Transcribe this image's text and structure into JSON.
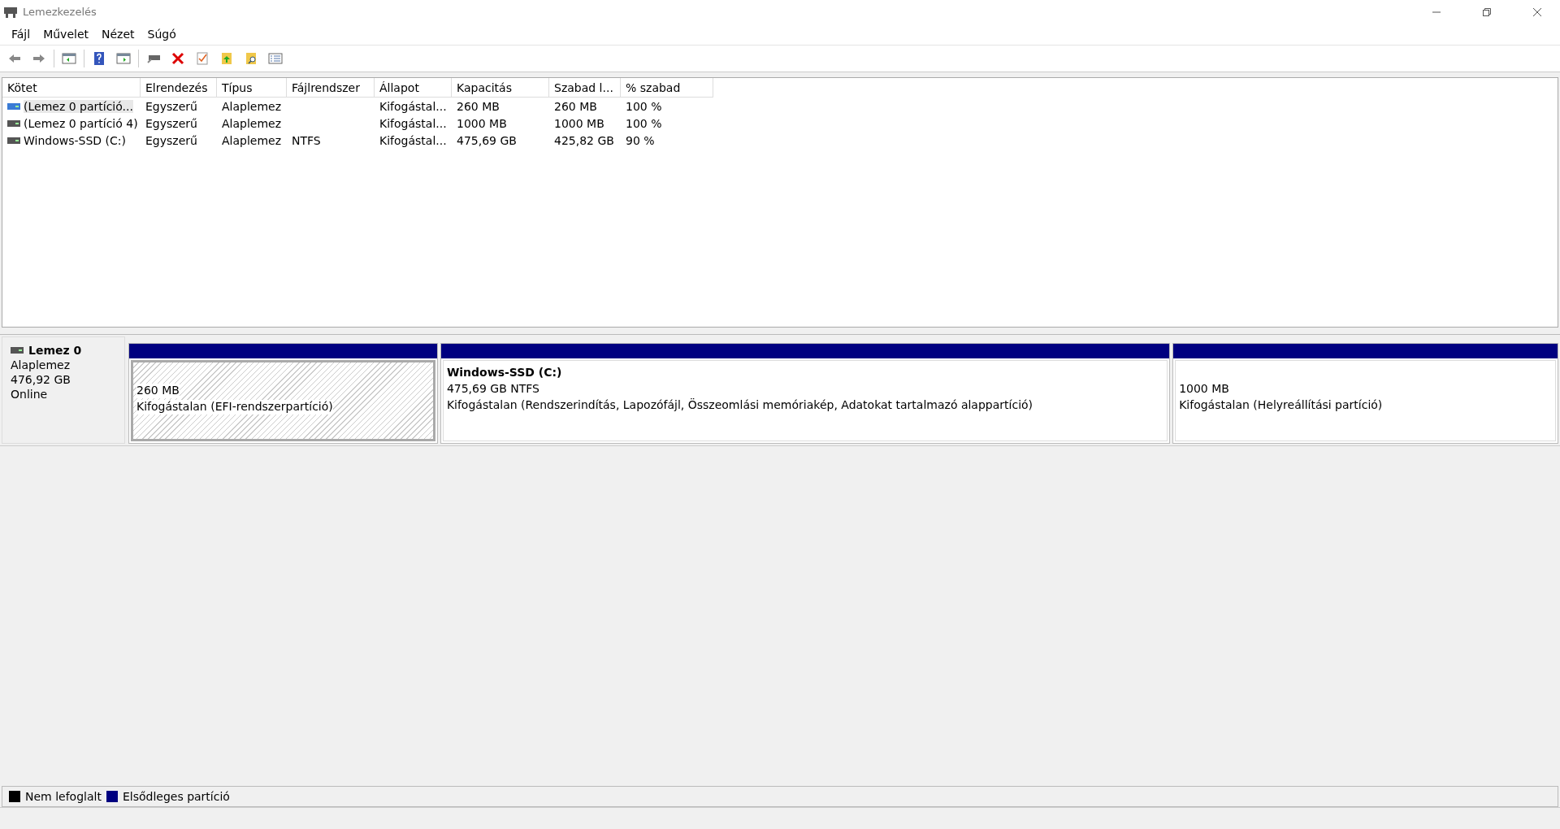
{
  "window": {
    "title": "Lemezkezelés"
  },
  "menu": [
    "Fájl",
    "Művelet",
    "Nézet",
    "Súgó"
  ],
  "table": {
    "columns": [
      "Kötet",
      "Elrendezés",
      "Típus",
      "Fájlrendszer",
      "Állapot",
      "Kapacitás",
      "Szabad l...",
      "% szabad"
    ],
    "rows": [
      {
        "selected": true,
        "cells": [
          "(Lemez 0 partíció...",
          "Egyszerű",
          "Alaplemez",
          "",
          "Kifogástal...",
          "260 MB",
          "260 MB",
          "100 %"
        ]
      },
      {
        "selected": false,
        "cells": [
          "(Lemez 0 partíció 4)",
          "Egyszerű",
          "Alaplemez",
          "",
          "Kifogástal...",
          "1000 MB",
          "1000 MB",
          "100 %"
        ]
      },
      {
        "selected": false,
        "cells": [
          "Windows-SSD (C:)",
          "Egyszerű",
          "Alaplemez",
          "NTFS",
          "Kifogástal...",
          "475,69 GB",
          "425,82 GB",
          "90 %"
        ]
      }
    ]
  },
  "disks": [
    {
      "name": "Lemez 0",
      "type": "Alaplemez",
      "size": "476,92 GB",
      "status": "Online",
      "partitions": [
        {
          "selected": true,
          "size": "260 MB",
          "status": "Kifogástalan (EFI-rendszerpartíció)"
        },
        {
          "selected": false,
          "title": "Windows-SSD  (C:)",
          "size": "475,69 GB NTFS",
          "status": "Kifogástalan (Rendszerindítás, Lapozófájl, Összeomlási memóriakép, Adatokat tartalmazó alappartíció)"
        },
        {
          "selected": false,
          "size": "1000 MB",
          "status": "Kifogástalan (Helyreállítási partíció)"
        }
      ]
    }
  ],
  "legend": [
    {
      "label": "Nem lefoglalt",
      "color": "#000000"
    },
    {
      "label": "Elsődleges partíció",
      "color": "#000080"
    }
  ]
}
